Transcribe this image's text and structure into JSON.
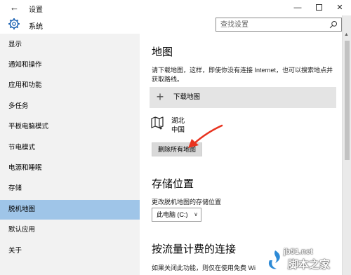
{
  "window": {
    "back_glyph": "←",
    "title": "设置",
    "minimize_glyph": "—",
    "close_glyph": "✕"
  },
  "header": {
    "section_title": "系统",
    "search_placeholder": "查找设置"
  },
  "sidebar": {
    "items": [
      {
        "label": "显示",
        "active": false
      },
      {
        "label": "通知和操作",
        "active": false
      },
      {
        "label": "应用和功能",
        "active": false
      },
      {
        "label": "多任务",
        "active": false
      },
      {
        "label": "平板电脑模式",
        "active": false
      },
      {
        "label": "节电模式",
        "active": false
      },
      {
        "label": "电源和睡眠",
        "active": false
      },
      {
        "label": "存储",
        "active": false
      },
      {
        "label": "脱机地图",
        "active": true
      },
      {
        "label": "默认应用",
        "active": false
      },
      {
        "label": "关于",
        "active": false
      }
    ]
  },
  "content": {
    "maps_heading": "地图",
    "maps_description": "请下载地图，这样，即使你没有连接 Internet，也可以搜索地点并获取路线。",
    "download_label": "下载地图",
    "download_plus": "+",
    "map_entry": {
      "name": "湖北",
      "country": "中国"
    },
    "delete_all_label": "删除所有地图",
    "storage_heading": "存储位置",
    "storage_label": "更改脱机地图的存储位置",
    "storage_value": "此电脑 (C:)",
    "metered_heading": "按流量计费的连接",
    "metered_description": "如果关闭此功能，则仅在使用免费 Wi"
  },
  "watermark": {
    "site": "jb51.net",
    "name": "脚本之家"
  },
  "colors": {
    "sidebar_bg": "#f2f2f2",
    "active_item": "#9fc5e8",
    "arrow": "#e8321e",
    "download_row_bg": "#e4e4e4",
    "button_bg": "#d9d9d9"
  }
}
